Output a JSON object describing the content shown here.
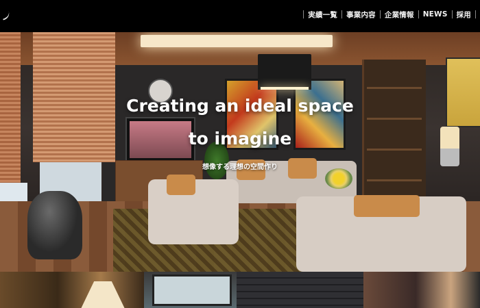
{
  "nav": {
    "items": [
      {
        "label": "実績一覧"
      },
      {
        "label": "事業内容"
      },
      {
        "label": "企業情報"
      },
      {
        "label": "NEWS"
      },
      {
        "label": "採用"
      }
    ]
  },
  "hero": {
    "title_line1": "Creating an ideal space",
    "title_line2": "to imagine",
    "subtitle": "想像する理想の空間作り"
  },
  "colors": {
    "header_bg": "#000000",
    "nav_text": "#f2f2f2",
    "hero_text": "#ffffff"
  }
}
